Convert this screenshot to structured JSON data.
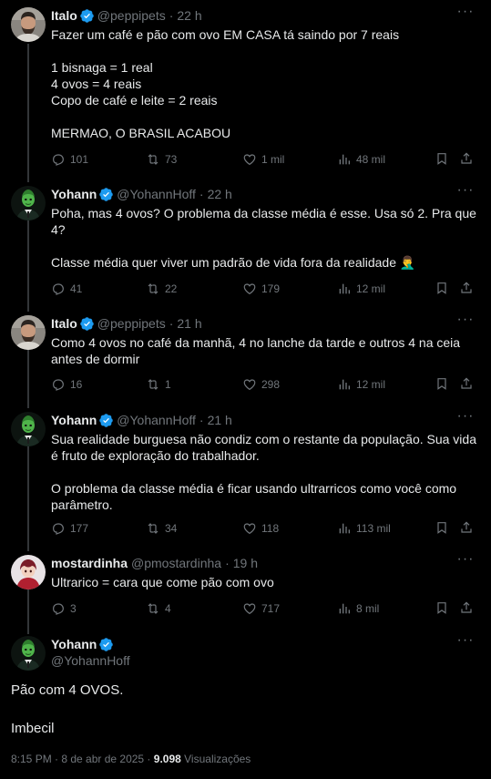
{
  "thread": [
    {
      "name": "Italo",
      "handle": "@peppipets",
      "time": "22 h",
      "text": "Fazer um café e pão com ovo EM CASA tá saindo por 7 reais\n\n1 bisnaga = 1 real\n4 ovos = 4 reais\nCopo de café e leite = 2 reais\n\nMERMAO, O BRASIL ACABOU",
      "replies": "101",
      "reposts": "73",
      "likes": "1 mil",
      "views": "48 mil",
      "avatar": "man-bearded-avatar"
    },
    {
      "name": "Yohann",
      "handle": "@YohannHoff",
      "time": "22 h",
      "text": "Poha, mas 4 ovos? O problema da classe média é esse. Usa só 2. Pra que 4?\n\nClasse média quer viver um padrão de vida fora da realidade 🤦‍♂️",
      "replies": "41",
      "reposts": "22",
      "likes": "179",
      "views": "12 mil",
      "avatar": "green-character-avatar"
    },
    {
      "name": "Italo",
      "handle": "@peppipets",
      "time": "21 h",
      "text": "Como 4 ovos no café da manhã, 4 no lanche da tarde e outros 4 na ceia antes de dormir",
      "replies": "16",
      "reposts": "1",
      "likes": "298",
      "views": "12 mil",
      "avatar": "man-bearded-avatar"
    },
    {
      "name": "Yohann",
      "handle": "@YohannHoff",
      "time": "21 h",
      "text": "Sua realidade burguesa não condiz com o restante da população. Sua vida é fruto de exploração do trabalhador.\n\nO problema da classe média é ficar usando ultrarricos como você como parâmetro.",
      "replies": "177",
      "reposts": "34",
      "likes": "118",
      "views": "113 mil",
      "avatar": "green-character-avatar"
    },
    {
      "name": "mostardinha",
      "handle": "@pmostardinha",
      "time": "19 h",
      "text": "Ultrarico = cara que come pão com ovo",
      "replies": "3",
      "reposts": "4",
      "likes": "717",
      "views": "8 mil",
      "avatar": "red-anime-avatar"
    }
  ],
  "main": {
    "name": "Yohann",
    "handle": "@YohannHoff",
    "text1": "Pão com 4 OVOS.",
    "text2": "Imbecil",
    "timestamp": "8:15 PM · 8 de abr de 2025 · ",
    "views_count": "9.098",
    "views_label": "Visualizações"
  },
  "colors": {
    "background": "#000000",
    "text": "#e7e9ea",
    "muted": "#71767b",
    "verified": "#1d9bf0",
    "divider": "#2f3336"
  },
  "icons": [
    "more-icon",
    "reply-icon",
    "repost-icon",
    "like-icon",
    "views-icon",
    "bookmark-icon",
    "share-icon",
    "verified-badge-icon"
  ]
}
